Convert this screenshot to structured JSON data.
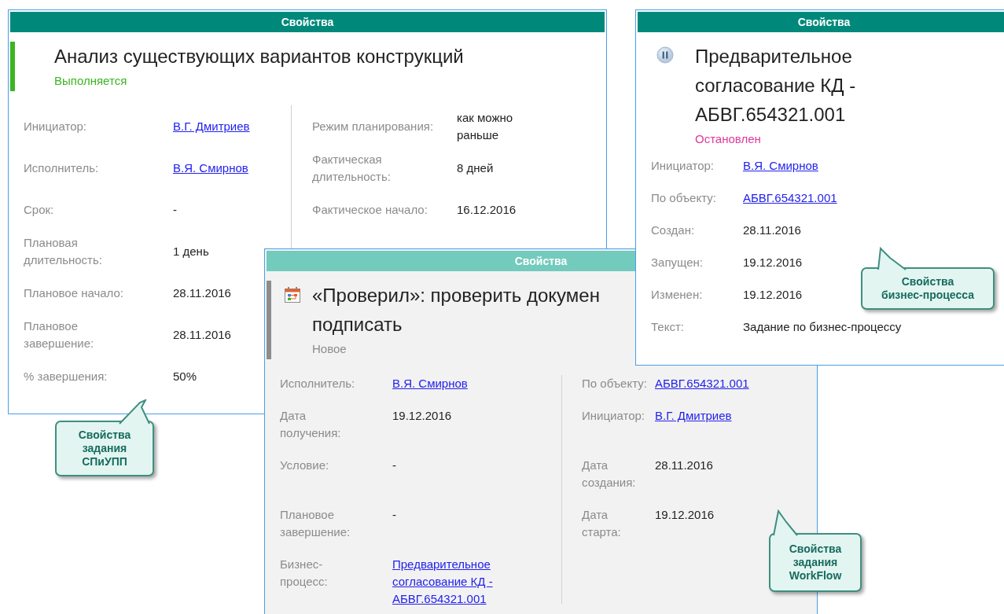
{
  "windows": [
    {
      "kind": "task",
      "active": true,
      "header": "Свойства",
      "title_lines": [
        "Анализ существующих вариантов конструкций"
      ],
      "status": "Выполняется",
      "color": "#3cb521",
      "rows": [
        [
          {
            "label": "Инициатор:",
            "value": "В.Г. Дмитриев",
            "kind": "link"
          },
          {
            "label": "Режим планирования:",
            "value": "как можно раньше",
            "kind": "text"
          }
        ],
        [
          {
            "label": "Исполнитель:",
            "value": "В.Я. Смирнов",
            "kind": "link"
          },
          {
            "label": "Фактическая длительность:",
            "value": "8 дней",
            "kind": "text"
          }
        ],
        [
          {
            "label": "Срок:",
            "value": "-",
            "kind": "text"
          },
          {
            "label": "Фактическое начало:",
            "value": "16.12.2016",
            "kind": "text"
          }
        ],
        [
          {
            "label": "Плановая длительность:",
            "value": "1 день",
            "kind": "text"
          }
        ],
        [
          {
            "label": "Плановое начало:",
            "value": "28.11.2016",
            "kind": "text"
          }
        ],
        [
          {
            "label": "Плановое завершение:",
            "value": "28.11.2016",
            "kind": "text"
          }
        ],
        [
          {
            "label": "% завершения:",
            "value": "50%",
            "kind": "text"
          }
        ]
      ]
    },
    {
      "kind": "process",
      "active": true,
      "header": "Свойства",
      "title_lines": [
        "Предварительное",
        "согласование КД -",
        "АБВГ.654321.001"
      ],
      "status": "Остановлен",
      "color": "#e0399b",
      "rows": [
        [
          {
            "label": "Инициатор:",
            "value": "В.Я. Смирнов",
            "kind": "link"
          }
        ],
        [
          {
            "label": "По объекту:",
            "value": "АБВГ.654321.001",
            "kind": "link"
          }
        ],
        [
          {
            "label": "Создан:",
            "value": "28.11.2016",
            "kind": "text"
          }
        ],
        [
          {
            "label": "Запущен:",
            "value": "19.12.2016",
            "kind": "text"
          }
        ],
        [
          {
            "label": "Изменен:",
            "value": "19.12.2016",
            "kind": "text"
          }
        ],
        [
          {
            "label": "Текст:",
            "value": "Задание по бизнес-процессу",
            "kind": "text"
          }
        ]
      ]
    },
    {
      "kind": "workflow",
      "active": false,
      "header": "Свойства",
      "title_lines": [
        "«Проверил»: проверить докумен",
        "подписать"
      ],
      "status": "Новое",
      "color": "#8c8c8c",
      "rows": [
        [
          {
            "label": "Исполнитель:",
            "value": "В.Я. Смирнов",
            "kind": "link"
          },
          {
            "label": "По объекту:",
            "value": "АБВГ.654321.001",
            "kind": "link"
          }
        ],
        [
          {
            "label": "Дата получения:",
            "value": "19.12.2016",
            "kind": "text"
          },
          {
            "label": "Инициатор:",
            "value": "В.Г. Дмитриев",
            "kind": "link"
          }
        ],
        [
          {
            "label": "Условие:",
            "value": "-",
            "kind": "text"
          },
          {
            "label": "Дата создания:",
            "value": "28.11.2016",
            "kind": "text"
          }
        ],
        [
          {
            "label": "Плановое завершение:",
            "value": "-",
            "kind": "text"
          },
          {
            "label": "Дата старта:",
            "value": "19.12.2016",
            "kind": "text"
          }
        ],
        [
          {
            "label": "Бизнес-процесс:",
            "value": "Предварительное согласование КД - АБВГ.654321.001",
            "kind": "link"
          }
        ]
      ]
    }
  ],
  "callouts": [
    {
      "lines": [
        "Свойства",
        "задания",
        "СПиУПП"
      ]
    },
    {
      "lines": [
        "Свойства",
        "бизнес-процесса"
      ]
    },
    {
      "lines": [
        "Свойства",
        "задания",
        "WorkFlow"
      ]
    }
  ]
}
